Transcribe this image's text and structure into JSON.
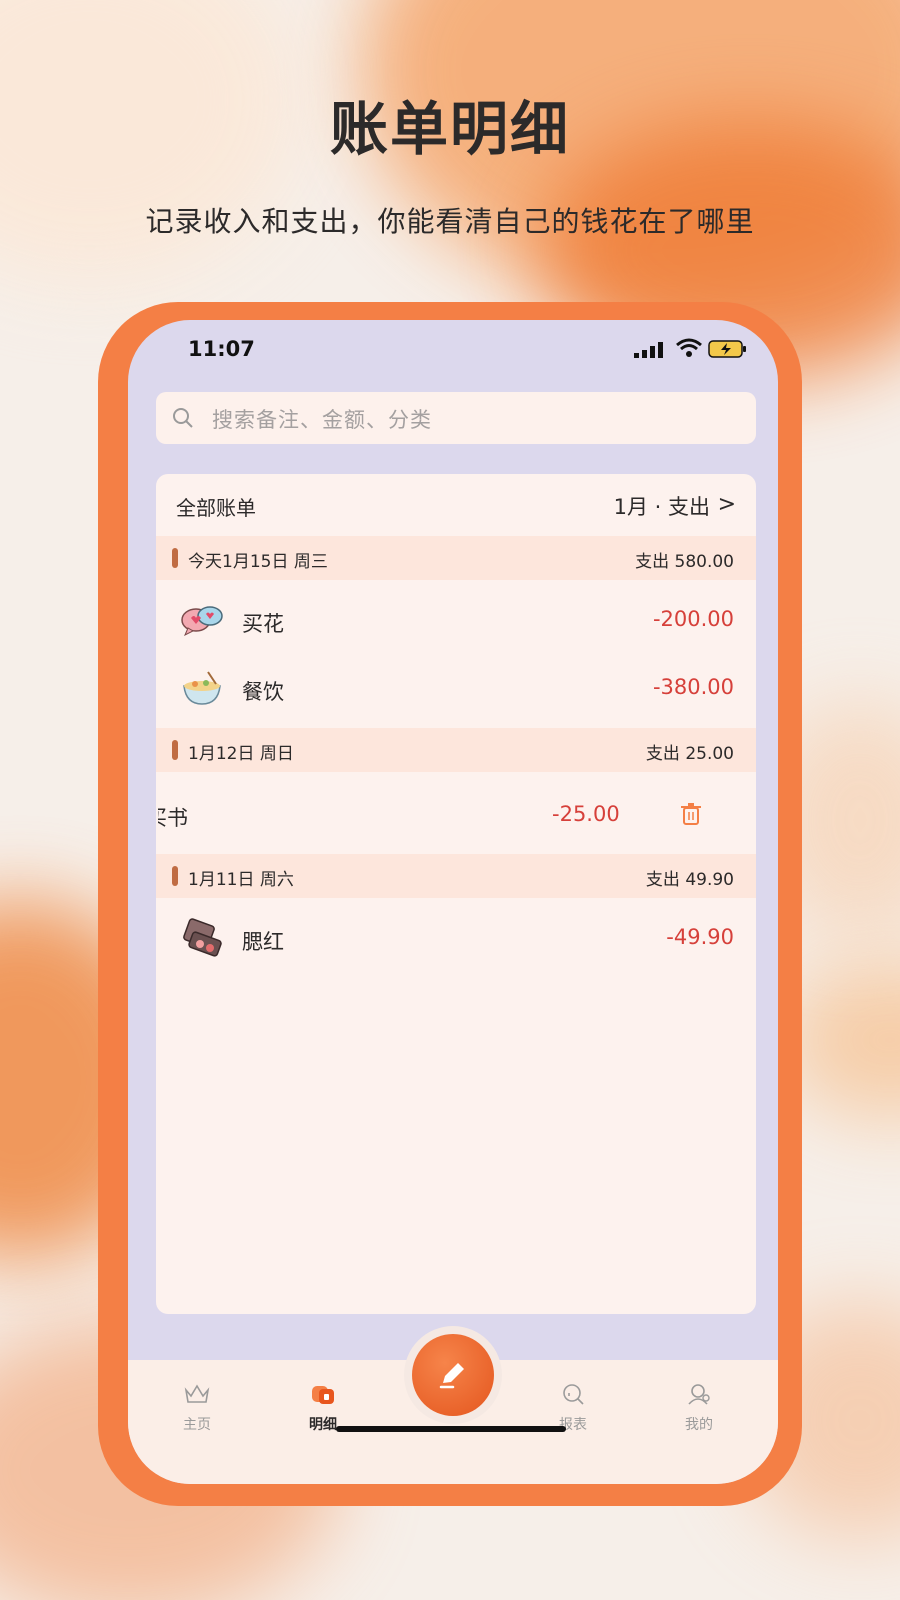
{
  "promo": {
    "title": "账单明细",
    "subtitle": "记录收入和支出，你能看清自己的钱花在了哪里"
  },
  "status_bar": {
    "time": "11:07"
  },
  "search": {
    "placeholder": "搜索备注、金额、分类"
  },
  "bill_header": {
    "title": "全部账单",
    "filter": "1月 · 支出",
    "chevron": ">"
  },
  "days": [
    {
      "label": "今天1月15日 周三",
      "total": "支出 580.00",
      "items": [
        {
          "name": "买花",
          "amount": "-200.00",
          "icon": "flower-speech-icon"
        },
        {
          "name": "餐饮",
          "amount": "-380.00",
          "icon": "noodle-bowl-icon"
        }
      ]
    },
    {
      "label": "1月12日 周日",
      "total": "支出 25.00",
      "items": [
        {
          "name": "买书",
          "name_visible": "买书",
          "amount": "-25.00",
          "icon": "book-icon",
          "swiped_open": true,
          "action": "delete-icon"
        }
      ]
    },
    {
      "label": "1月11日 周六",
      "total": "支出 49.90",
      "items": [
        {
          "name": "腮红",
          "amount": "-49.90",
          "icon": "blush-palette-icon"
        }
      ]
    }
  ],
  "tabs": [
    {
      "label": "主页",
      "icon": "crown-icon",
      "active": false
    },
    {
      "label": "明细",
      "icon": "cards-icon",
      "active": true
    },
    {
      "label": "报表",
      "icon": "report-icon",
      "active": false
    },
    {
      "label": "我的",
      "icon": "profile-icon",
      "active": false
    }
  ],
  "fab": {
    "icon": "pencil-icon"
  },
  "colors": {
    "accent": "#f47f45",
    "expense": "#d6403a",
    "panel": "#fdf2ee",
    "day_header": "#fde6dc"
  }
}
